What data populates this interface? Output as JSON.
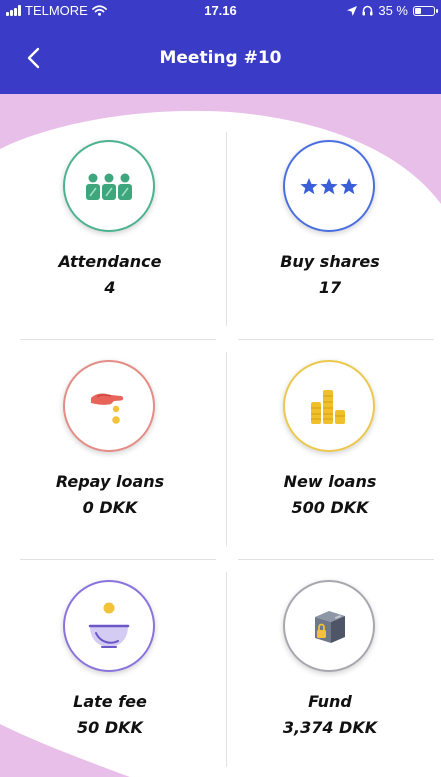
{
  "status_bar": {
    "carrier": "TELMORE",
    "time": "17.16",
    "battery": "35 %",
    "battery_level": 0.35
  },
  "header": {
    "title": "Meeting #10",
    "back_icon": "chevron-left-icon"
  },
  "colors": {
    "header_bg": "#3a3bc6",
    "background_wave": "#e8bfe8"
  },
  "tiles": [
    {
      "label": "Attendance",
      "value": "4",
      "icon": "people-icon",
      "ring": "#4db28e"
    },
    {
      "label": "Buy shares",
      "value": "17",
      "icon": "stars-icon",
      "ring": "#4b6fe0"
    },
    {
      "label": "Repay loans",
      "value": "0 DKK",
      "icon": "hand-coin-icon",
      "ring": "#e48c86"
    },
    {
      "label": "New loans",
      "value": "500 DKK",
      "icon": "coins-icon",
      "ring": "#ecc94e"
    },
    {
      "label": "Late fee",
      "value": "50 DKK",
      "icon": "bowl-coin-icon",
      "ring": "#8a73dd"
    },
    {
      "label": "Fund",
      "value": "3,374 DKK",
      "icon": "safe-box-icon",
      "ring": "#a7a7b0"
    }
  ]
}
